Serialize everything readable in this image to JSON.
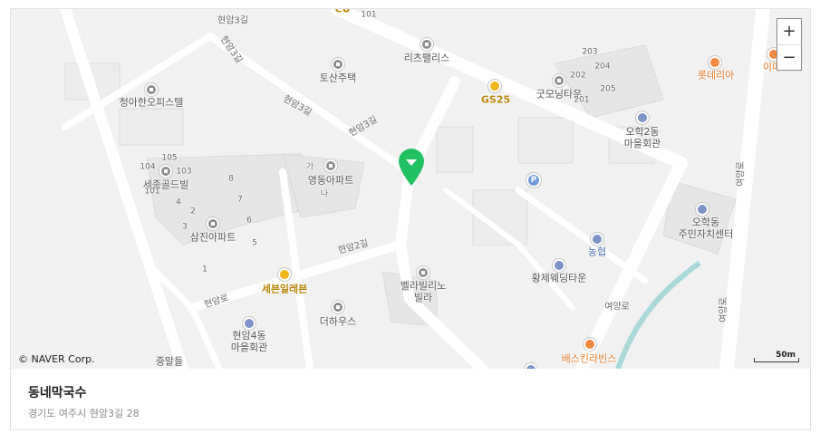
{
  "map": {
    "poi_labels": [
      {
        "id": "lotteria",
        "text": "롯데리아",
        "style": "orange"
      },
      {
        "id": "emart",
        "text": "이마",
        "style": "orange"
      },
      {
        "id": "ritz",
        "text": "리츠팰리스",
        "style": ""
      },
      {
        "id": "tosan",
        "text": "토산주택",
        "style": ""
      },
      {
        "id": "gs25",
        "text": "GS25",
        "style": "gold"
      },
      {
        "id": "goodmorning",
        "text": "굿모닝타운",
        "style": ""
      },
      {
        "id": "ohak2",
        "text": "오학2동\n마을회관",
        "style": ""
      },
      {
        "id": "cheonga",
        "text": "청아한오피스텔",
        "style": ""
      },
      {
        "id": "sejong",
        "text": "세종골드빌",
        "style": ""
      },
      {
        "id": "youngdong",
        "text": "영동아파트",
        "style": ""
      },
      {
        "id": "samjin",
        "text": "삼진아파트",
        "style": ""
      },
      {
        "id": "ohakdong",
        "text": "오학동\n주민자치센터",
        "style": ""
      },
      {
        "id": "nonghyup",
        "text": "농협",
        "style": "blue"
      },
      {
        "id": "hwangje",
        "text": "황제웨딩타운",
        "style": ""
      },
      {
        "id": "seven",
        "text": "세븐일레븐",
        "style": "gold"
      },
      {
        "id": "bella",
        "text": "벨라빌리노\n빌라",
        "style": ""
      },
      {
        "id": "thehouse",
        "text": "더하우스",
        "style": ""
      },
      {
        "id": "hyeonam4",
        "text": "현암4동\n마을회관",
        "style": ""
      },
      {
        "id": "baskin",
        "text": "배스킨라빈스",
        "style": "orange"
      },
      {
        "id": "jungmal",
        "text": "중말들",
        "style": ""
      },
      {
        "id": "ga",
        "text": "가",
        "style": "small"
      },
      {
        "id": "na",
        "text": "나",
        "style": "small"
      }
    ],
    "road_labels": [
      {
        "id": "r1",
        "text": "현암3길"
      },
      {
        "id": "r2",
        "text": "현암3길"
      },
      {
        "id": "r3",
        "text": "현암3길"
      },
      {
        "id": "r4",
        "text": "현암3길"
      },
      {
        "id": "r5",
        "text": "현암2길"
      },
      {
        "id": "r6",
        "text": "현암로"
      },
      {
        "id": "r7",
        "text": "여양로"
      },
      {
        "id": "r8",
        "text": "여양로"
      },
      {
        "id": "r9",
        "text": "여양로"
      }
    ],
    "numbers": [
      "101",
      "203",
      "204",
      "202",
      "205",
      "201",
      "105",
      "104",
      "103",
      "101",
      "8",
      "4",
      "7",
      "2",
      "6",
      "3",
      "5",
      "1"
    ],
    "top_cut_label": "CU",
    "copyright": "© NAVER Corp.",
    "scale_label": "50m",
    "zoom_in_label": "+",
    "zoom_out_label": "−",
    "colors": {
      "pin": "#21c063",
      "road": "#ffffff",
      "block": "#e5e5e5",
      "water": "#a9d9d9"
    }
  },
  "place": {
    "name": "동네막국수",
    "address": "경기도 여주시 현암3길 28"
  }
}
